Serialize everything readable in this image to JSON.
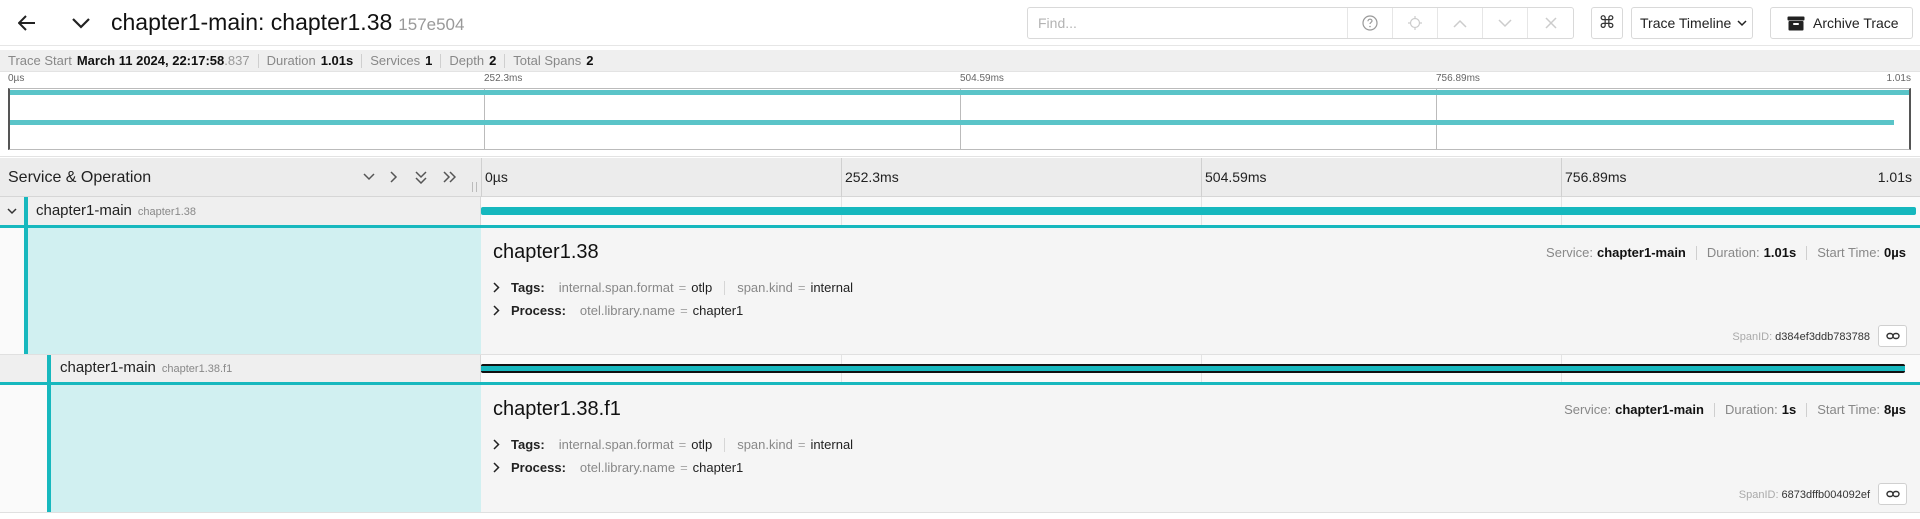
{
  "header": {
    "title": "chapter1-main: chapter1.38",
    "trace_id": "157e504",
    "find_placeholder": "Find...",
    "find_value": "",
    "shortcut_glyph": "⌘",
    "view_select": "Trace Timeline",
    "archive_label": "Archive Trace"
  },
  "summary": {
    "trace_start_label": "Trace Start",
    "trace_start_value": "March 11 2024, 22:17:58",
    "trace_start_ms": ".837",
    "duration_label": "Duration",
    "duration_value": "1.01s",
    "services_label": "Services",
    "services_value": "1",
    "depth_label": "Depth",
    "depth_value": "2",
    "total_spans_label": "Total Spans",
    "total_spans_value": "2"
  },
  "minimap": {
    "ticks": [
      "0µs",
      "252.3ms",
      "504.59ms",
      "756.89ms",
      "1.01s"
    ]
  },
  "timeline": {
    "column_title": "Service & Operation",
    "ticks": [
      "0µs",
      "252.3ms",
      "504.59ms",
      "756.89ms",
      "1.01s"
    ]
  },
  "colors": {
    "service_accent": "#17b8be",
    "detail_left_fill": "#d1f0f1"
  },
  "spans": [
    {
      "service": "chapter1-main",
      "operation": "chapter1.38",
      "depth": 0,
      "start_fraction": 0.0,
      "duration_fraction": 1.0,
      "detail": {
        "title": "chapter1.38",
        "service_label": "Service:",
        "service_value": "chapter1-main",
        "duration_label": "Duration:",
        "duration_value": "1.01s",
        "start_label": "Start Time:",
        "start_value": "0µs",
        "tags_label": "Tags:",
        "tags": [
          {
            "key": "internal.span.format",
            "value": "otlp"
          },
          {
            "key": "span.kind",
            "value": "internal"
          }
        ],
        "process_label": "Process:",
        "process": [
          {
            "key": "otel.library.name",
            "value": "chapter1"
          }
        ],
        "span_id_label": "SpanID:",
        "span_id": "d384ef3ddb783788"
      }
    },
    {
      "service": "chapter1-main",
      "operation": "chapter1.38.f1",
      "depth": 1,
      "start_fraction": 0.0,
      "duration_fraction": 0.992,
      "detail": {
        "title": "chapter1.38.f1",
        "service_label": "Service:",
        "service_value": "chapter1-main",
        "duration_label": "Duration:",
        "duration_value": "1s",
        "start_label": "Start Time:",
        "start_value": "8µs",
        "tags_label": "Tags:",
        "tags": [
          {
            "key": "internal.span.format",
            "value": "otlp"
          },
          {
            "key": "span.kind",
            "value": "internal"
          }
        ],
        "process_label": "Process:",
        "process": [
          {
            "key": "otel.library.name",
            "value": "chapter1"
          }
        ],
        "span_id_label": "SpanID:",
        "span_id": "6873dffb004092ef"
      }
    }
  ]
}
